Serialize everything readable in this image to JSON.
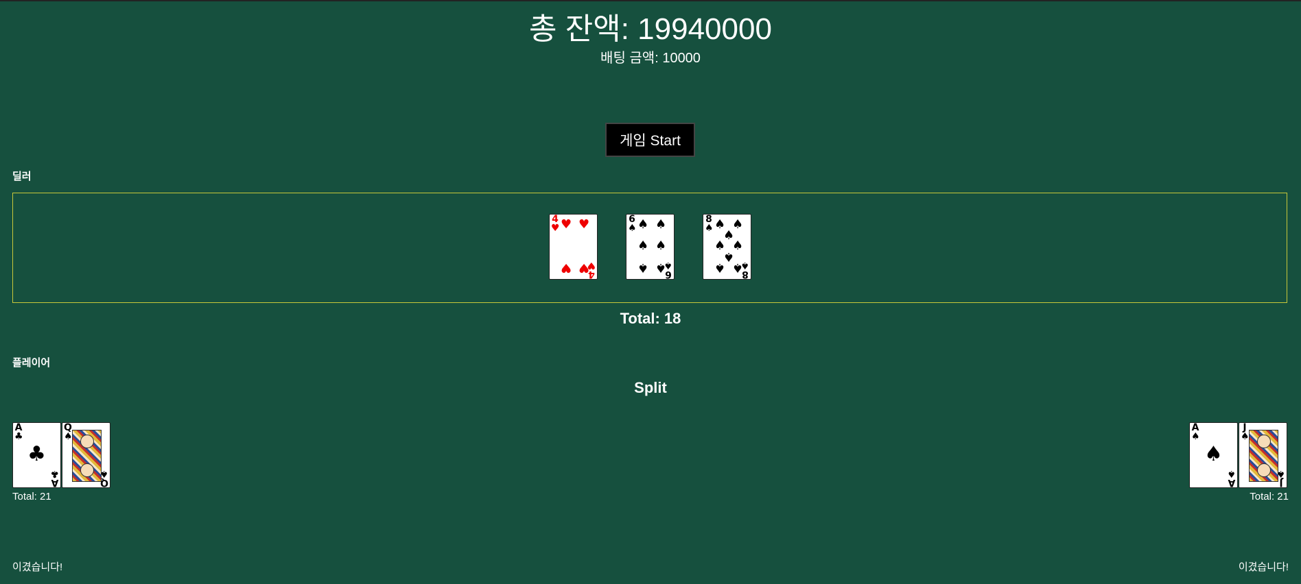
{
  "header": {
    "balance": "총 잔액: 19940000",
    "bet": "배팅 금액: 10000"
  },
  "controls": {
    "start_label": "게임 Start"
  },
  "dealer": {
    "label": "딜러",
    "cards": [
      {
        "rank": "4",
        "suit": "♥"
      },
      {
        "rank": "6",
        "suit": "♠"
      },
      {
        "rank": "8",
        "suit": "♠"
      }
    ],
    "total": "Total: 18"
  },
  "player": {
    "label": "플레이어",
    "split_title": "Split",
    "hands": [
      {
        "cards": [
          {
            "rank": "A",
            "suit": "♣"
          },
          {
            "rank": "Q",
            "suit": "♠"
          }
        ],
        "total": "Total: 21",
        "result": "이겼습니다!"
      },
      {
        "cards": [
          {
            "rank": "A",
            "suit": "♠"
          },
          {
            "rank": "J",
            "suit": "♠"
          }
        ],
        "total": "Total: 21",
        "result": "이겼습니다!"
      }
    ]
  }
}
